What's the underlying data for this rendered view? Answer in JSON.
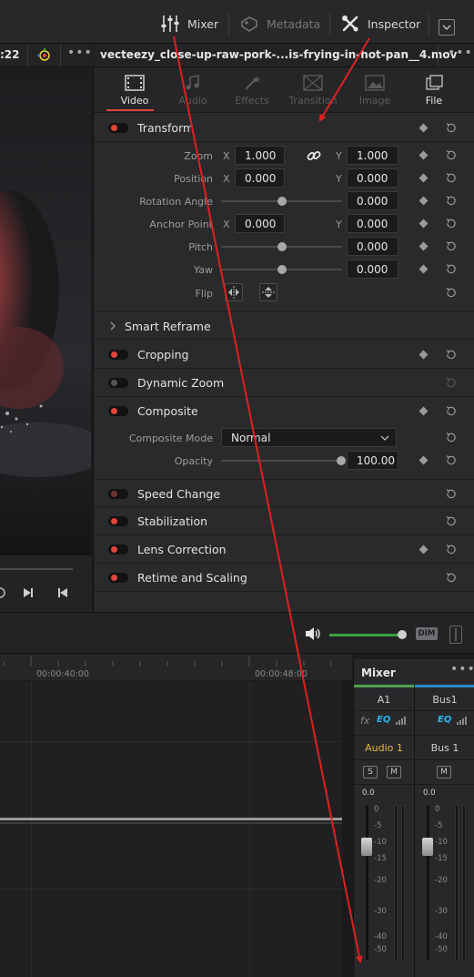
{
  "toolbar": {
    "mixer_label": "Mixer",
    "metadata_label": "Metadata",
    "inspector_label": "Inspector"
  },
  "viewer": {
    "timecode_fragment": ":22"
  },
  "inspector": {
    "clip_title": "vecteezy_close-up-raw-pork-...is-frying-in-hot-pan__4.mov",
    "tabs": [
      {
        "label": "Video",
        "icon": "film-icon",
        "active": true
      },
      {
        "label": "Audio",
        "icon": "music-note-icon",
        "active": false
      },
      {
        "label": "Effects",
        "icon": "magic-wand-icon",
        "active": false
      },
      {
        "label": "Transition",
        "icon": "transition-icon",
        "active": false
      },
      {
        "label": "Image",
        "icon": "image-icon",
        "active": false
      },
      {
        "label": "File",
        "icon": "file-icon",
        "active": false
      }
    ],
    "transform": {
      "title": "Transform",
      "zoom_label": "Zoom",
      "zoom_x": "1.000",
      "zoom_y": "1.000",
      "position_label": "Position",
      "position_x": "0.000",
      "position_y": "0.000",
      "rotation_label": "Rotation Angle",
      "rotation_value": "0.000",
      "anchor_label": "Anchor Point",
      "anchor_x": "0.000",
      "anchor_y": "0.000",
      "pitch_label": "Pitch",
      "pitch_value": "0.000",
      "yaw_label": "Yaw",
      "yaw_value": "0.000",
      "flip_label": "Flip",
      "x_axis": "X",
      "y_axis": "Y"
    },
    "smart_reframe": "Smart Reframe",
    "cropping": "Cropping",
    "dynamic_zoom": "Dynamic Zoom",
    "composite": {
      "title": "Composite",
      "mode_label": "Composite Mode",
      "mode_value": "Normal",
      "opacity_label": "Opacity",
      "opacity_value": "100.00"
    },
    "speed_change": "Speed Change",
    "stabilization": "Stabilization",
    "lens_correction": "Lens Correction",
    "retime_scaling": "Retime and Scaling"
  },
  "audio_bar": {
    "dim_label": "DIM",
    "monitor_volume": 1.0
  },
  "timeline": {
    "tc_1": "00:00:40:00",
    "tc_2": "00:00:48:00"
  },
  "mixer": {
    "title": "Mixer",
    "channels": [
      "A1",
      "Bus1"
    ],
    "fx_label": "fx",
    "eq_label": "EQ",
    "track_names": [
      "Audio 1",
      "Bus 1"
    ],
    "solo_label": "S",
    "mute_label": "M",
    "fader_value": "0.0",
    "scale": [
      "0",
      "-5",
      "-10",
      "-15",
      "-20",
      "-30",
      "-40",
      "-50"
    ]
  },
  "colors": {
    "accent_red": "#e0463c",
    "annotation_arrow": "#e02020",
    "track_name": "#e8b83a",
    "eq_cyan": "#2fb4e8"
  }
}
